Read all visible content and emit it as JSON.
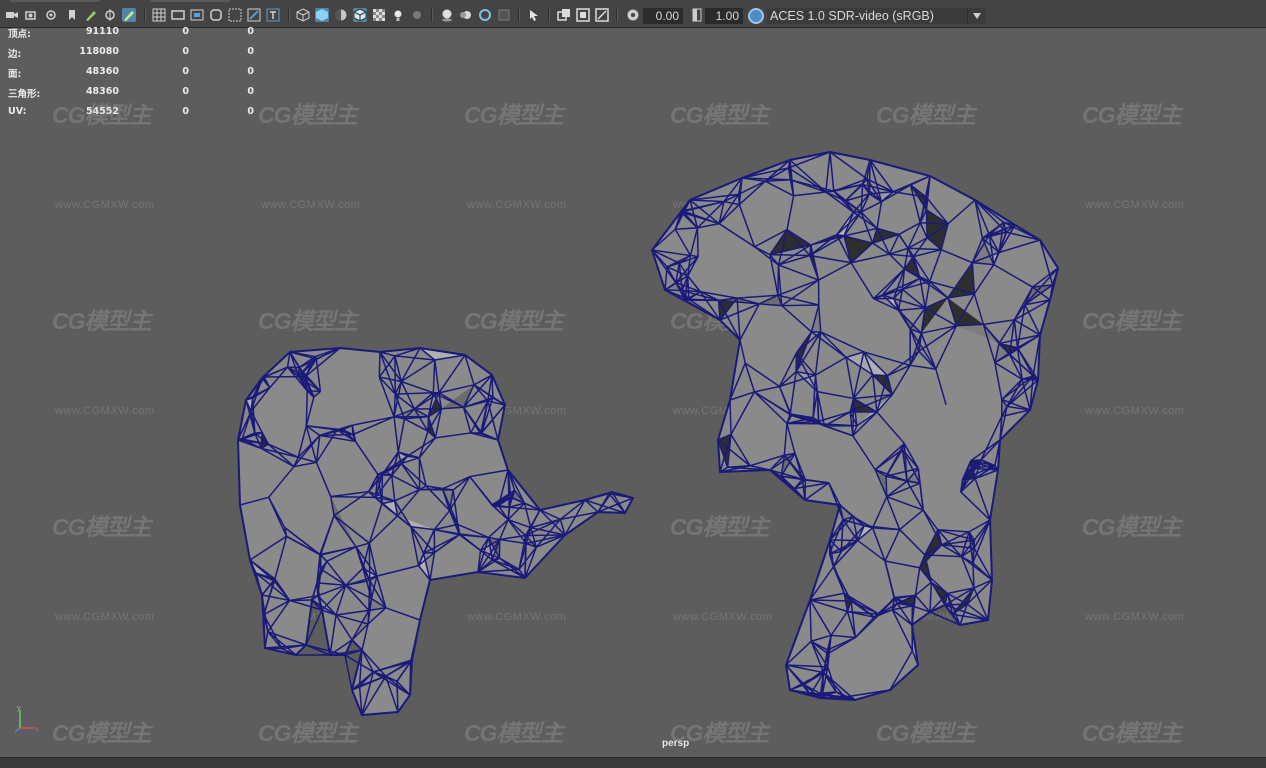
{
  "toolbar": {
    "gamma_value": "0.00",
    "exposure_value": "1.00",
    "color_space": "ACES 1.0 SDR-video (sRGB)"
  },
  "hud": {
    "rows": [
      {
        "label": "顶点:",
        "v1": "91110",
        "v2": "0",
        "v3": "0"
      },
      {
        "label": "边:",
        "v1": "118080",
        "v2": "0",
        "v3": "0"
      },
      {
        "label": "面:",
        "v1": "48360",
        "v2": "0",
        "v3": "0"
      },
      {
        "label": "三角形:",
        "v1": "48360",
        "v2": "0",
        "v3": "0"
      },
      {
        "label": "UV:",
        "v1": "54552",
        "v2": "0",
        "v3": "0"
      }
    ]
  },
  "watermark": {
    "logo_text": "CG模型主",
    "url_text": "www.CGMXW.com"
  },
  "viewport": {
    "camera_name": "persp"
  },
  "colors": {
    "viewport_bg": "#5d5d5d",
    "wire": "#1a1a7a",
    "shaded": "#8e8e8e",
    "active_icon": "#5285a6"
  }
}
